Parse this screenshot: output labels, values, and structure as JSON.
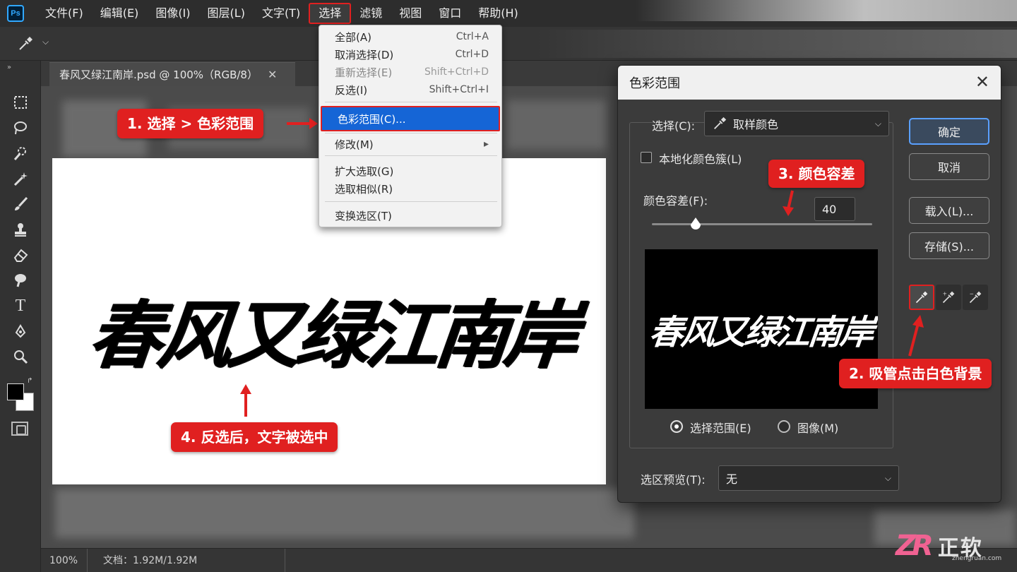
{
  "menubar": {
    "logo": "Ps",
    "items": [
      "文件(F)",
      "编辑(E)",
      "图像(I)",
      "图层(L)",
      "文字(T)",
      "选择",
      "滤镜",
      "视图",
      "窗口",
      "帮助(H)"
    ],
    "active_index": 5
  },
  "document": {
    "tab_title": "春风又绿江南岸.psd  @ 100%（RGB/8）",
    "text": "春风又绿江南岸"
  },
  "select_menu": {
    "items": [
      {
        "label": "全部(A)",
        "shortcut": "Ctrl+A",
        "enabled": true
      },
      {
        "label": "取消选择(D)",
        "shortcut": "Ctrl+D",
        "enabled": true
      },
      {
        "label": "重新选择(E)",
        "shortcut": "Shift+Ctrl+D",
        "enabled": false
      },
      {
        "label": "反选(I)",
        "shortcut": "Shift+Ctrl+I",
        "enabled": true
      },
      {
        "label": "色彩范围(C)...",
        "shortcut": "",
        "enabled": true,
        "highlighted": true
      },
      {
        "label": "修改(M)",
        "shortcut": "",
        "enabled": true,
        "submenu": true
      },
      {
        "label": "扩大选取(G)",
        "shortcut": "",
        "enabled": true
      },
      {
        "label": "选取相似(R)",
        "shortcut": "",
        "enabled": true
      },
      {
        "label": "变换选区(T)",
        "shortcut": "",
        "enabled": true
      }
    ]
  },
  "dialog": {
    "title": "色彩范围",
    "select_label": "选择(C):",
    "select_value": "取样颜色",
    "localized_label": "本地化颜色簇(L)",
    "localized_checked": false,
    "fuzziness_label": "颜色容差(F):",
    "fuzziness_value": "40",
    "fuzziness_max": 200,
    "preview_text": "春风又绿江南岸",
    "radio_selection": "选择范围(E)",
    "radio_image": "图像(M)",
    "radio_selected": "selection",
    "preview_mode_label": "选区预览(T):",
    "preview_mode_value": "无",
    "buttons": {
      "ok": "确定",
      "cancel": "取消",
      "load": "载入(L)...",
      "save": "存储(S)..."
    }
  },
  "callouts": {
    "c1": "1. 选择 > 色彩范围",
    "c2": "2. 吸管点击白色背景",
    "c3": "3. 颜色容差",
    "c4": "4. 反选后，文字被选中"
  },
  "statusbar": {
    "zoom": "100%",
    "doc_info": "文档：1.92M/1.92M"
  },
  "watermark": {
    "logo": "ZR",
    "name": "正软",
    "url": "zhengruan.com"
  },
  "colors": {
    "accent_red": "#e02020",
    "highlight_blue": "#1565d6",
    "ps_blue": "#31a8ff"
  }
}
